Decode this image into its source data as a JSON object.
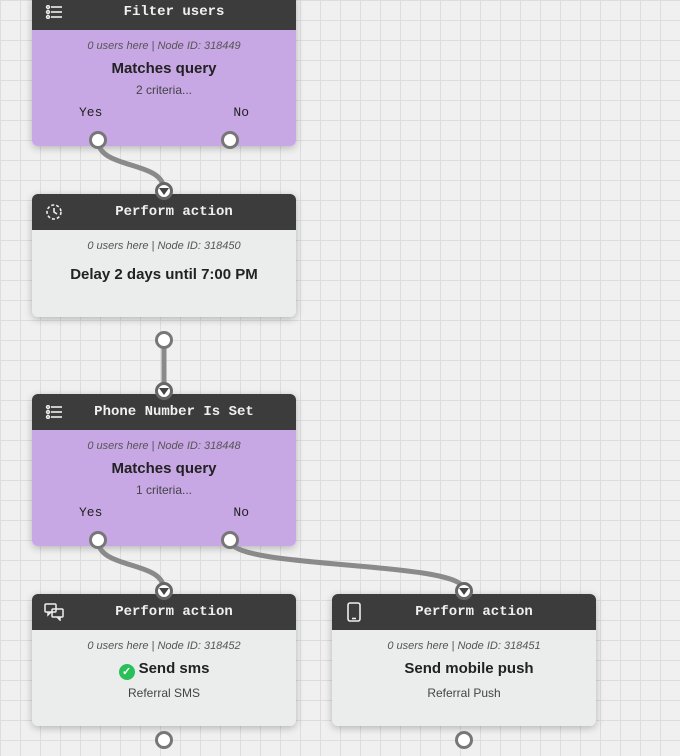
{
  "nodes": {
    "filter1": {
      "title": "Filter users",
      "users": "0 users here",
      "nodeid": "Node ID: 318449",
      "main": "Matches query",
      "sub": "2 criteria...",
      "yes": "Yes",
      "no": "No"
    },
    "action_delay": {
      "title": "Perform action",
      "users": "0 users here",
      "nodeid": "Node ID: 318450",
      "main": "Delay 2 days until 7:00 PM"
    },
    "filter2": {
      "title": "Phone Number Is Set",
      "users": "0 users here",
      "nodeid": "Node ID: 318448",
      "main": "Matches query",
      "sub": "1 criteria...",
      "yes": "Yes",
      "no": "No"
    },
    "action_sms": {
      "title": "Perform action",
      "users": "0 users here",
      "nodeid": "Node ID: 318452",
      "main": "Send sms",
      "sub": "Referral SMS"
    },
    "action_push": {
      "title": "Perform action",
      "users": "0 users here",
      "nodeid": "Node ID: 318451",
      "main": "Send mobile push",
      "sub": "Referral Push"
    }
  },
  "labels": {
    "sep": " | "
  }
}
